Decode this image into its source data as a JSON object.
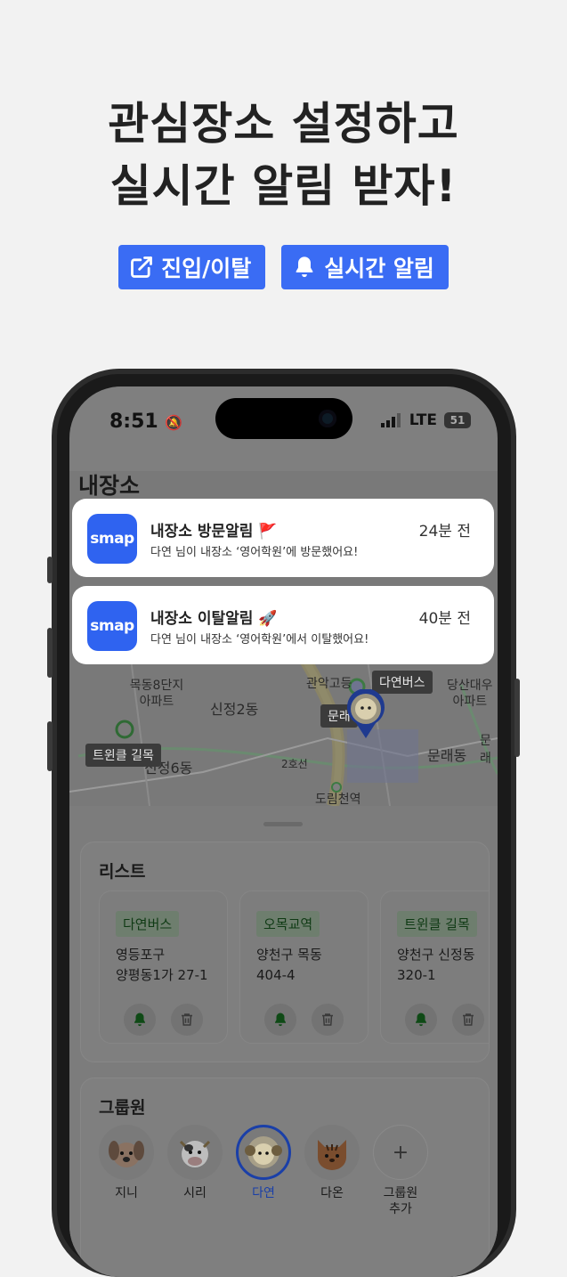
{
  "headline": {
    "line1": "관심장소 설정하고",
    "line2": "실시간 알림 받자!"
  },
  "badges": [
    {
      "label": "진입/이탈",
      "icon": "external-link-icon"
    },
    {
      "label": "실시간 알림",
      "icon": "bell-icon"
    }
  ],
  "status": {
    "time": "8:51",
    "network": "LTE",
    "battery": "51"
  },
  "map": {
    "title": "내장소",
    "labels": [
      "목동8단지\n아파트",
      "신정2동",
      "신정6동",
      "관악고등",
      "당산대우\n아파트",
      "문래동",
      "문래",
      "도림천역",
      "2호선"
    ],
    "chips": [
      "다연버스",
      "트윈클 길목",
      "문래"
    ]
  },
  "notifications": [
    {
      "app": "smap",
      "title": "내장소 방문알림 🚩",
      "body": "다연 님이 내장소 ‘영어학원’에 방문했어요!",
      "time": "24분 전"
    },
    {
      "app": "smap",
      "title": "내장소 이탈알림 🚀",
      "body": "다연 님이 내장소 ‘영어학원’에서 이탈했어요!",
      "time": "40분 전"
    }
  ],
  "list": {
    "title": "리스트",
    "items": [
      {
        "tag": "다연버스",
        "addr1": "영등포구",
        "addr2": "양평동1가 27-1"
      },
      {
        "tag": "오목교역",
        "addr1": "양천구 목동",
        "addr2": "404-4"
      },
      {
        "tag": "트윈클 길목",
        "addr1": "양천구 신정동",
        "addr2": "320-1"
      }
    ]
  },
  "group": {
    "title": "그룹원",
    "members": [
      {
        "name": "지니",
        "icon": "dog-avatar-icon"
      },
      {
        "name": "시리",
        "icon": "cow-avatar-icon"
      },
      {
        "name": "다연",
        "icon": "sheep-avatar-icon",
        "selected": true
      },
      {
        "name": "다온",
        "icon": "cat-avatar-icon"
      }
    ],
    "add_label_1": "그룹원",
    "add_label_2": "추가",
    "add_symbol": "+"
  },
  "colors": {
    "accent": "#3a6cf4",
    "brand": "#2f63f0",
    "selected": "#1a3fa8"
  }
}
